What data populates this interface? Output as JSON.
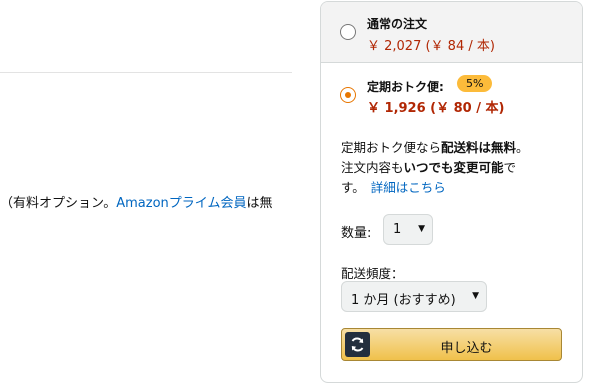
{
  "left": {
    "text_prefix": "（有料オプション。",
    "link_text": "Amazonプライム会員",
    "text_suffix": "は無"
  },
  "buybox": {
    "one_time": {
      "title": "通常の注文",
      "price": "￥ 2,027 (￥ 84 / 本)"
    },
    "subscribe": {
      "title": "定期おトク便:",
      "discount_badge": "5%",
      "price": "￥ 1,926 (￥ 80 / 本)"
    },
    "description": {
      "line1_a": "定期おトク便なら",
      "line1_b": "配送料は無料",
      "line1_c": "。",
      "line2_a": "注文内容も",
      "line2_b": "いつでも変更可能",
      "line2_c": "で",
      "line3_a": "す。",
      "details_link": "詳細はこちら"
    },
    "quantity": {
      "label": "数量:",
      "selected": "1"
    },
    "frequency": {
      "label": "配送頻度：",
      "selected": "1 か月 (おすすめ)"
    },
    "subscribe_button": {
      "label": "申し込む",
      "icon": "refresh-icon"
    }
  },
  "colors": {
    "price": "#b12704",
    "link": "#0066c0",
    "radio_selected": "#e77600",
    "badge": "#fcbb3a",
    "button": "#f0c14b",
    "button_icon_bg": "#232f3e"
  }
}
